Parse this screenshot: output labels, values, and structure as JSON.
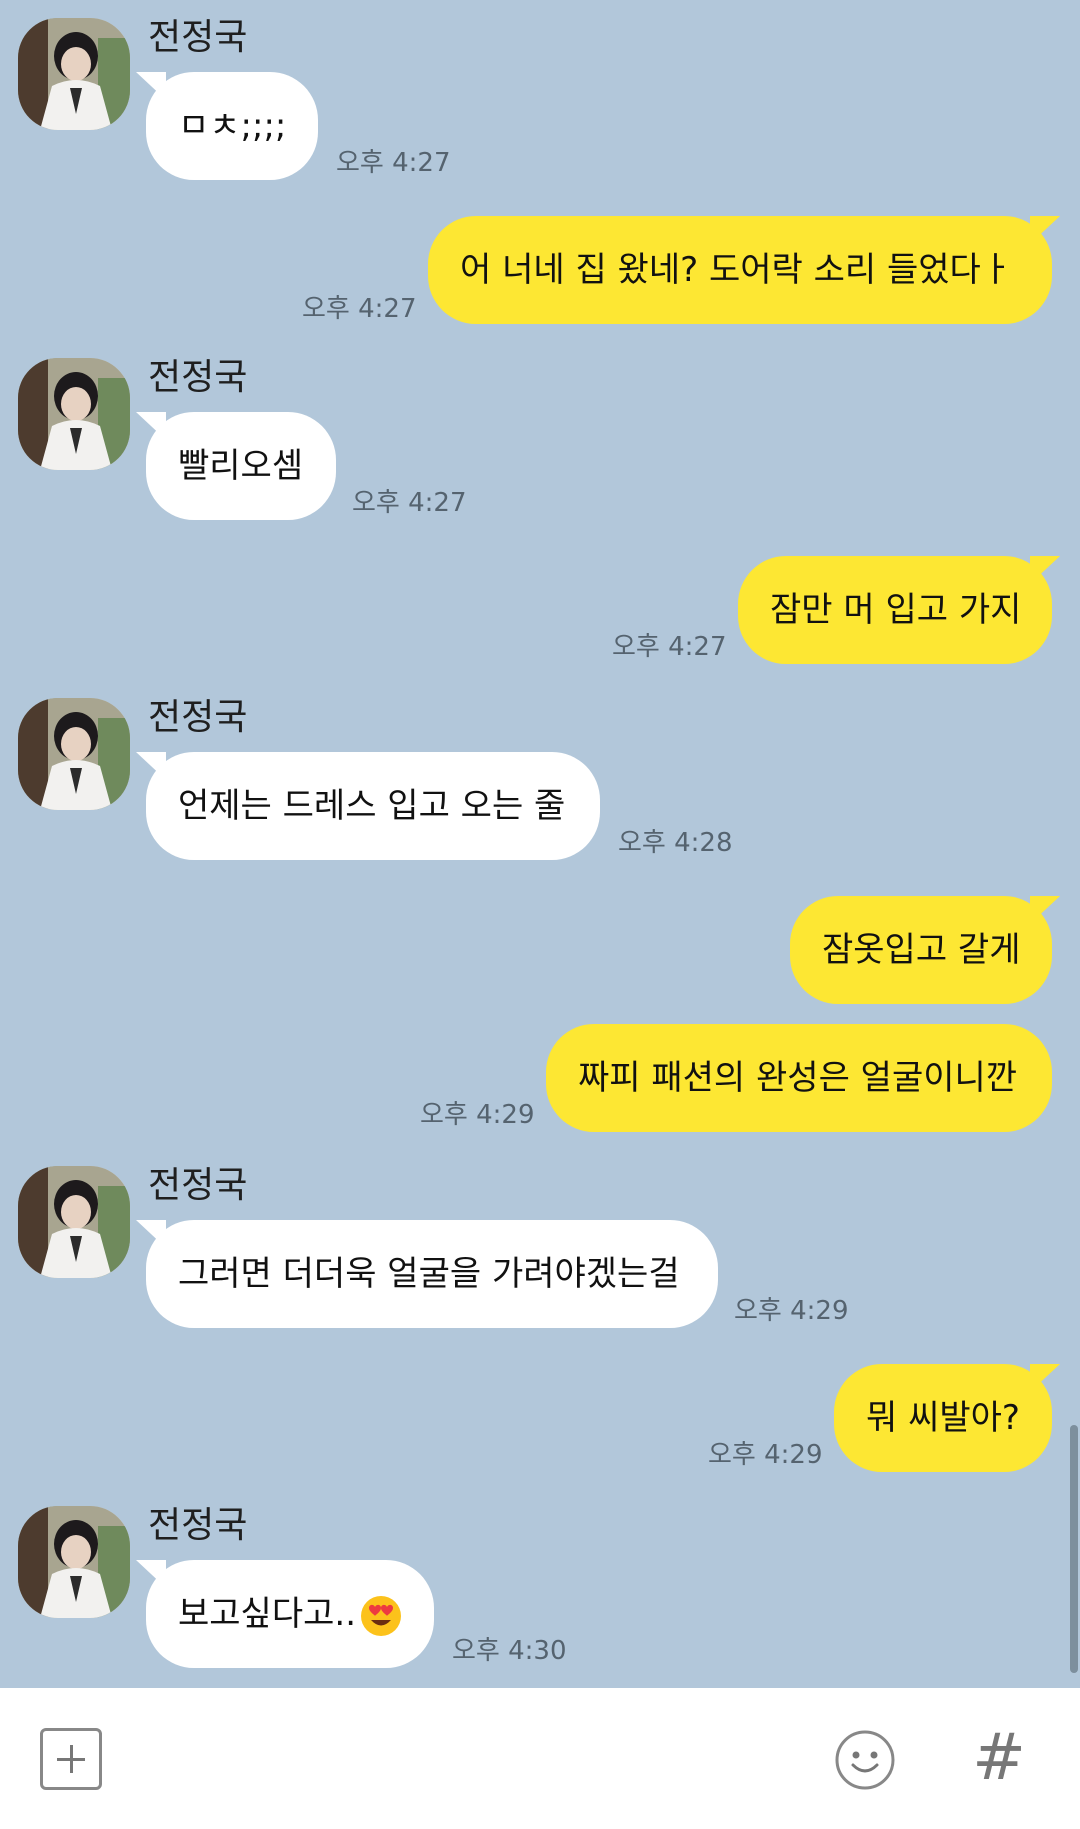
{
  "contact_name": "전정국",
  "messages": [
    {
      "dir": "in",
      "text": "ㅁㅊ;;;;",
      "time": "오후 4:27",
      "show_name": true
    },
    {
      "dir": "out",
      "text": "어 너네 집 왔네? 도어락 소리 들었다ㅏ",
      "time": "오후 4:27"
    },
    {
      "dir": "in",
      "text": "빨리오셈",
      "time": "오후 4:27",
      "show_name": true
    },
    {
      "dir": "out",
      "text": "잠만 머 입고 가지",
      "time": "오후 4:27"
    },
    {
      "dir": "in",
      "text": "언제는 드레스 입고 오는 줄",
      "time": "오후 4:28",
      "show_name": true
    },
    {
      "dir": "out",
      "text": "잠옷입고 갈게",
      "time": ""
    },
    {
      "dir": "out",
      "text": "짜피 패션의 완성은 얼굴이니깐",
      "time": "오후 4:29"
    },
    {
      "dir": "in",
      "text": "그러면 더더욱 얼굴을 가려야겠는걸",
      "time": "오후 4:29",
      "show_name": true
    },
    {
      "dir": "out",
      "text": "뭐 씨발아?",
      "time": "오후 4:29"
    },
    {
      "dir": "in",
      "text": "보고싶다고..",
      "emoji": "heart-eyes-emoji",
      "time": "오후 4:30",
      "show_name": true
    }
  ],
  "input_bar": {
    "plus_icon": "plus-icon",
    "emoji_icon": "emoji-icon",
    "hash_icon": "#"
  },
  "colors": {
    "chat_bg": "#b2c7da",
    "incoming_bubble": "#ffffff",
    "outgoing_bubble": "#fde733"
  }
}
